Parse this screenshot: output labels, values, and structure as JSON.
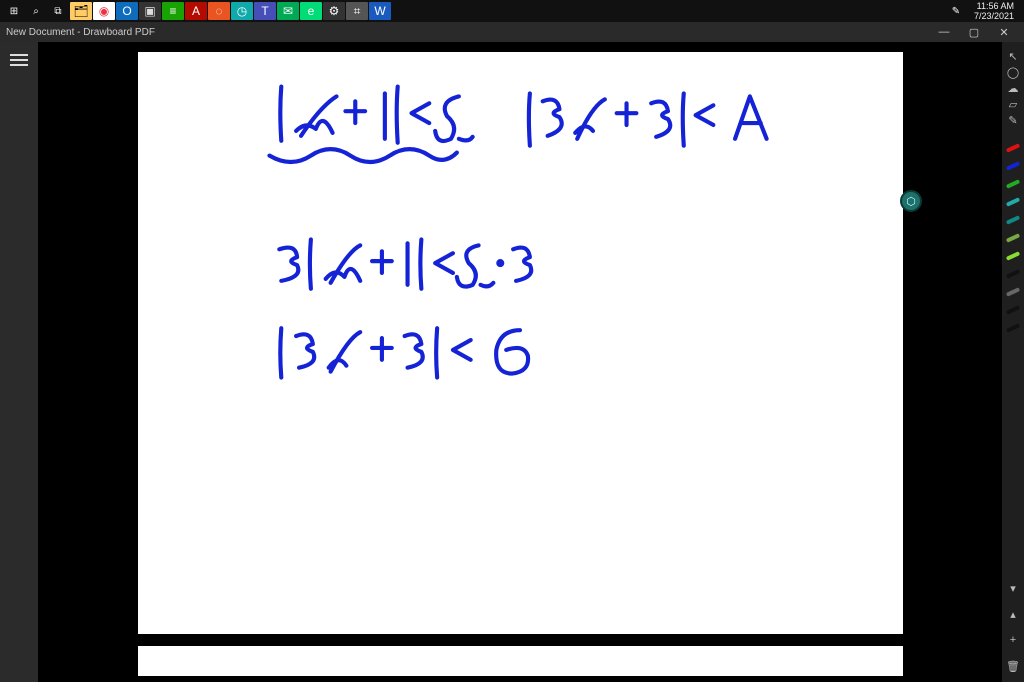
{
  "taskbar": {
    "start": "⊞",
    "search": "⌕",
    "taskview": "⧉",
    "apps": [
      {
        "name": "file-explorer",
        "glyph": "🗂",
        "bg": "#ffcc66"
      },
      {
        "name": "chrome",
        "glyph": "◉",
        "bg": "#fff",
        "color": "#e34"
      },
      {
        "name": "outlook",
        "glyph": "O",
        "bg": "#0f6cbd",
        "color": "#fff"
      },
      {
        "name": "terminal",
        "glyph": "▣",
        "bg": "#333",
        "color": "#ddd"
      },
      {
        "name": "libre",
        "glyph": "≡",
        "bg": "#18a303",
        "color": "#fff"
      },
      {
        "name": "acrobat",
        "glyph": "A",
        "bg": "#b30b00",
        "color": "#fff"
      },
      {
        "name": "ubuntu",
        "glyph": "◌",
        "bg": "#e95420",
        "color": "#fff"
      },
      {
        "name": "drawboard",
        "glyph": "◷",
        "bg": "#1aa",
        "color": "#fff"
      },
      {
        "name": "teams",
        "glyph": "T",
        "bg": "#464eb8",
        "color": "#fff"
      },
      {
        "name": "mail",
        "glyph": "✉",
        "bg": "#0a5",
        "color": "#fff"
      },
      {
        "name": "edge",
        "glyph": "e",
        "bg": "#0d7",
        "color": "#fff"
      },
      {
        "name": "settings",
        "glyph": "⚙",
        "bg": "#333",
        "color": "#fff"
      },
      {
        "name": "calc",
        "glyph": "⌗",
        "bg": "#555",
        "color": "#fff"
      },
      {
        "name": "word",
        "glyph": "W",
        "bg": "#185abd",
        "color": "#fff"
      }
    ],
    "pen": "✎",
    "time": "11:56 AM",
    "date": "7/23/2021"
  },
  "app": {
    "title": "New Document - Drawboard PDF",
    "minimize": "—",
    "maximize": "▢",
    "close": "✕"
  },
  "leftRail": {
    "menu": "≡"
  },
  "floating": {
    "glyph": "⬡"
  },
  "rightRail": {
    "tools": [
      {
        "name": "selection-tool-icon",
        "glyph": "↖"
      },
      {
        "name": "lasso-tool-icon",
        "glyph": "◯"
      },
      {
        "name": "cloud-icon",
        "glyph": "☁"
      },
      {
        "name": "eraser-icon",
        "glyph": "▱"
      },
      {
        "name": "pen-icon",
        "glyph": "✎"
      }
    ],
    "pens": [
      {
        "name": "pen-red",
        "color": "#d11"
      },
      {
        "name": "pen-blue",
        "color": "#1523d6"
      },
      {
        "name": "pen-green",
        "color": "#2a2"
      },
      {
        "name": "pen-cyan",
        "color": "#2aa"
      },
      {
        "name": "pen-teal",
        "color": "#188"
      },
      {
        "name": "pen-olive",
        "color": "#7a4"
      },
      {
        "name": "pen-lime",
        "color": "#8d3"
      },
      {
        "name": "pen-black1",
        "color": "#111"
      },
      {
        "name": "pen-gray",
        "color": "#666"
      },
      {
        "name": "pen-black2",
        "color": "#111"
      },
      {
        "name": "pen-black3",
        "color": "#111"
      }
    ],
    "bottomTools": [
      {
        "name": "chevron-icon",
        "glyph": "▾"
      },
      {
        "name": "chevron-up-icon",
        "glyph": "▴"
      },
      {
        "name": "plus-icon",
        "glyph": "+"
      },
      {
        "name": "trash-icon",
        "glyph": "🗑"
      }
    ]
  },
  "handwriting": {
    "line1": "|x+1| < 2",
    "line1b": "|3x+3| < A",
    "line2": "3|x+1| < 2·3",
    "line3": "|3x+3| < 6"
  }
}
